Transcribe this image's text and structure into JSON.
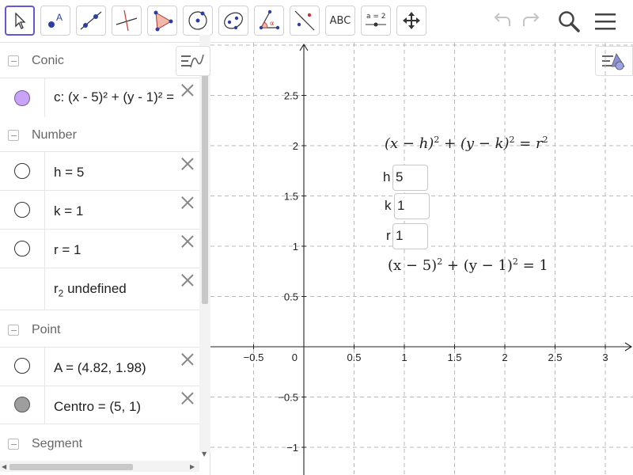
{
  "toolbar": {
    "tools": [
      {
        "name": "move-tool",
        "icon": "cursor-arrow-icon",
        "selected": true
      },
      {
        "name": "point-tool",
        "icon": "point-icon",
        "label": "A"
      },
      {
        "name": "line-tool",
        "icon": "line-through-points-icon"
      },
      {
        "name": "perpendicular-line-tool",
        "icon": "perpendicular-line-icon"
      },
      {
        "name": "polygon-tool",
        "icon": "polygon-icon"
      },
      {
        "name": "circle-center-point-tool",
        "icon": "circle-center-icon"
      },
      {
        "name": "ellipse-tool",
        "icon": "ellipse-icon"
      },
      {
        "name": "angle-tool",
        "icon": "angle-icon",
        "label": "α"
      },
      {
        "name": "reflect-tool",
        "icon": "reflect-about-line-icon"
      },
      {
        "name": "text-tool",
        "icon": "text-icon",
        "label": "ABC"
      },
      {
        "name": "slider-tool",
        "icon": "slider-icon",
        "label": "a = 2"
      },
      {
        "name": "move-graphics-view-tool",
        "icon": "move-arrows-icon"
      }
    ],
    "right_icons": [
      "undo-icon",
      "redo-icon",
      "search-icon",
      "menu-icon"
    ]
  },
  "algebra": {
    "sections": {
      "conic": "Conic",
      "number": "Number",
      "point": "Point",
      "segment": "Segment"
    },
    "rows": {
      "c": "c: (x - 5)² + (y - 1)² =",
      "h": "h = 5",
      "k": "k = 1",
      "r": "r = 1",
      "r2_name": "r",
      "r2_sub": "2",
      "r2_rest": " undefined",
      "A": "A = (4.82, 1.98)",
      "centro": "Centro = (5, 1)"
    },
    "colors": {
      "conic_marker": "#c9a3f5",
      "conic_marker_border": "#7a5aa8",
      "centro_marker": "#9e9e9e"
    }
  },
  "graphics": {
    "general_formula": {
      "a": "(x − h)",
      "b": " + (y − k)",
      "c": " = r",
      "exp": "2"
    },
    "inputs": {
      "h_label": "h",
      "h_value": "5",
      "k_label": "k",
      "k_value": "1",
      "r_label": "r",
      "r_value": "1"
    },
    "specific_formula": {
      "a": "(x − 5)",
      "b": " + (y − 1)",
      "c": " = 1",
      "exp": "2"
    },
    "axes": {
      "x_ticks": [
        {
          "value": -0.5,
          "label": "−0.5"
        },
        {
          "value": 0.5,
          "label": "0.5"
        },
        {
          "value": 1,
          "label": "1"
        },
        {
          "value": 1.5,
          "label": "1.5"
        },
        {
          "value": 2,
          "label": "2"
        },
        {
          "value": 2.5,
          "label": "2.5"
        },
        {
          "value": 3,
          "label": "3"
        }
      ],
      "y_ticks": [
        {
          "value": 2.5,
          "label": "2.5"
        },
        {
          "value": 2,
          "label": "2"
        },
        {
          "value": 1.5,
          "label": "1.5"
        },
        {
          "value": 1,
          "label": "1"
        },
        {
          "value": 0.5,
          "label": "0.5"
        },
        {
          "value": -0.5,
          "label": "−0.5"
        },
        {
          "value": -1,
          "label": "−1"
        }
      ],
      "origin_label": "0",
      "grid": true,
      "grid_color": "#b8b8b8"
    }
  }
}
